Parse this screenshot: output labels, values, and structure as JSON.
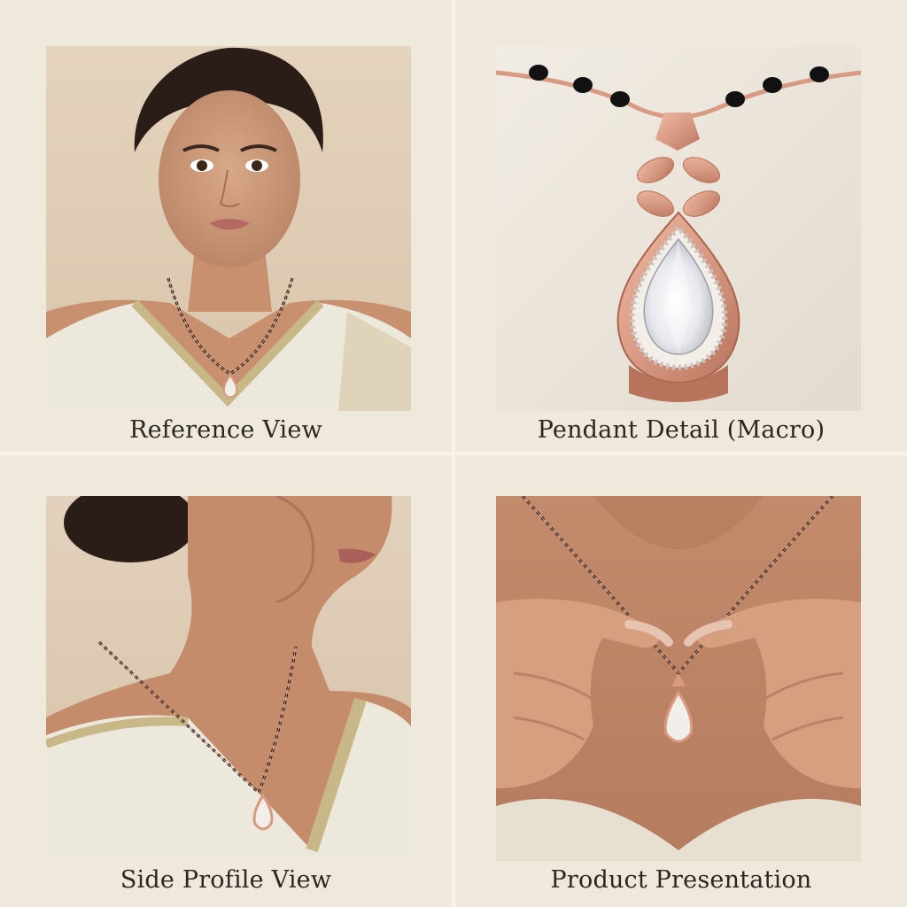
{
  "panels": [
    {
      "caption": "Reference View",
      "image": "woman-front-portrait-mangalsutra"
    },
    {
      "caption": "Pendant Detail (Macro)",
      "image": "rose-gold-teardrop-pendant-closeup"
    },
    {
      "caption": "Side Profile View",
      "image": "woman-side-profile-mangalsutra"
    },
    {
      "caption": "Product Presentation",
      "image": "hands-holding-mangalsutra-chain"
    }
  ],
  "colors": {
    "background": "#efe9dc",
    "divider": "#f7f3ea",
    "caption_text": "#2b2622",
    "rose_gold": "#d89a83",
    "black_bead": "#151515"
  }
}
